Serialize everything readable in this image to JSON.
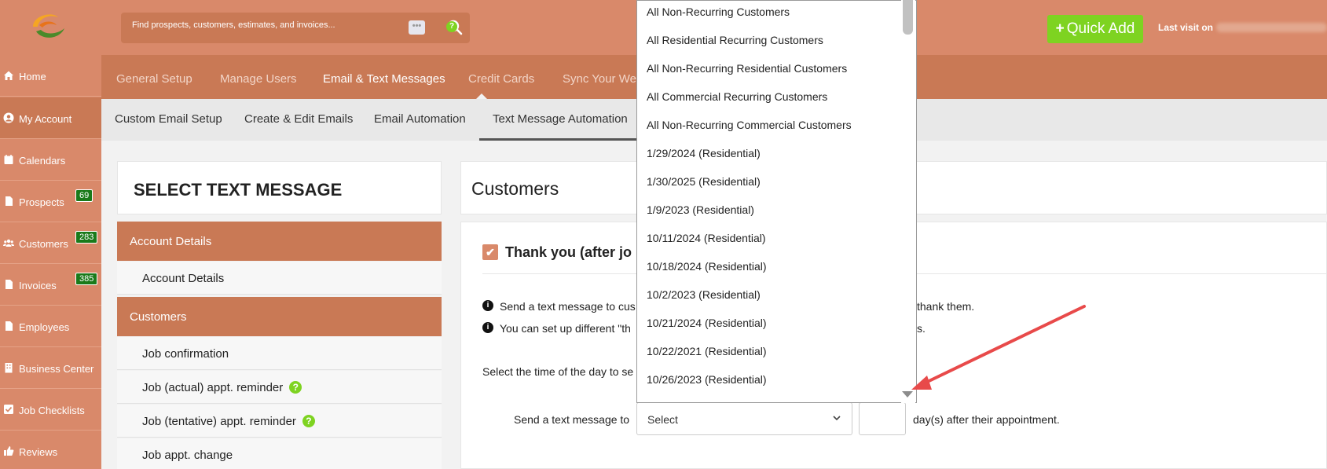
{
  "header": {
    "search_placeholder": "Find prospects, customers, estimates, and invoices...",
    "dots_label": "•••",
    "help_label": "?",
    "quick_add_plus": "+",
    "quick_add_label": "Quick Add",
    "last_visit_label": "Last visit on"
  },
  "sidebar": {
    "items": [
      {
        "label": "Home",
        "icon": "home-icon"
      },
      {
        "label": "My Account",
        "icon": "user-icon"
      },
      {
        "label": "Calendars",
        "icon": "calendar-icon"
      },
      {
        "label": "Prospects",
        "icon": "document-icon",
        "badge": "69"
      },
      {
        "label": "Customers",
        "icon": "users-icon",
        "badge": "283"
      },
      {
        "label": "Invoices",
        "icon": "document-icon",
        "badge": "385"
      },
      {
        "label": "Employees",
        "icon": "document-icon"
      },
      {
        "label": "Business Center",
        "icon": "building-icon"
      },
      {
        "label": "Job Checklists",
        "icon": "checkbox-icon"
      },
      {
        "label": "Reviews",
        "icon": "thumbs-up-icon"
      }
    ]
  },
  "nav": {
    "tabs": [
      "General Setup",
      "Manage Users",
      "Email & Text Messages",
      "Credit Cards",
      "Sync Your Web"
    ],
    "active": "Email & Text Messages"
  },
  "subnav": {
    "tabs": [
      "Custom Email Setup",
      "Create & Edit Emails",
      "Email Automation",
      "Text Message Automation"
    ],
    "active": "Text Message Automation"
  },
  "left_panel": {
    "title": "SELECT TEXT MESSAGE",
    "sections": [
      {
        "heading": "Account Details",
        "items": [
          "Account Details"
        ]
      },
      {
        "heading": "Customers",
        "items": [
          "Job confirmation",
          "Job (actual) appt. reminder",
          "Job (tentative) appt. reminder",
          "Job appt. change"
        ]
      }
    ],
    "help_label": "?"
  },
  "right_panel": {
    "title": "Customers",
    "message_title": "Thank you (after jo",
    "checkmark": "✔",
    "info_icon": "i",
    "info_lines": [
      "Send a text message to cus",
      "You can set up different \"th"
    ],
    "info_line_tails": [
      "thank them.",
      "s."
    ],
    "time_label": "Select the time of the day to se",
    "send_label": "Send a text message to",
    "select_value": "Select",
    "after_label": "day(s) after their appointment."
  },
  "dropdown": {
    "options": [
      "All Non-Recurring Customers",
      "All Residential Recurring Customers",
      "All Non-Recurring Residential Customers",
      "All Commercial Recurring Customers",
      "All Non-Recurring Commercial Customers",
      "1/29/2024 (Residential)",
      "1/30/2025 (Residential)",
      "1/9/2023 (Residential)",
      "10/11/2024 (Residential)",
      "10/18/2024 (Residential)",
      "10/2/2023 (Residential)",
      "10/21/2024 (Residential)",
      "10/22/2021 (Residential)",
      "10/26/2023 (Residential)"
    ]
  },
  "colors": {
    "header_bg": "#d9896a",
    "nav_bg": "#c97955",
    "accent_green": "#7ed321",
    "badge_green": "#1a7a1a",
    "annotation_arrow": "#e84a4a"
  }
}
